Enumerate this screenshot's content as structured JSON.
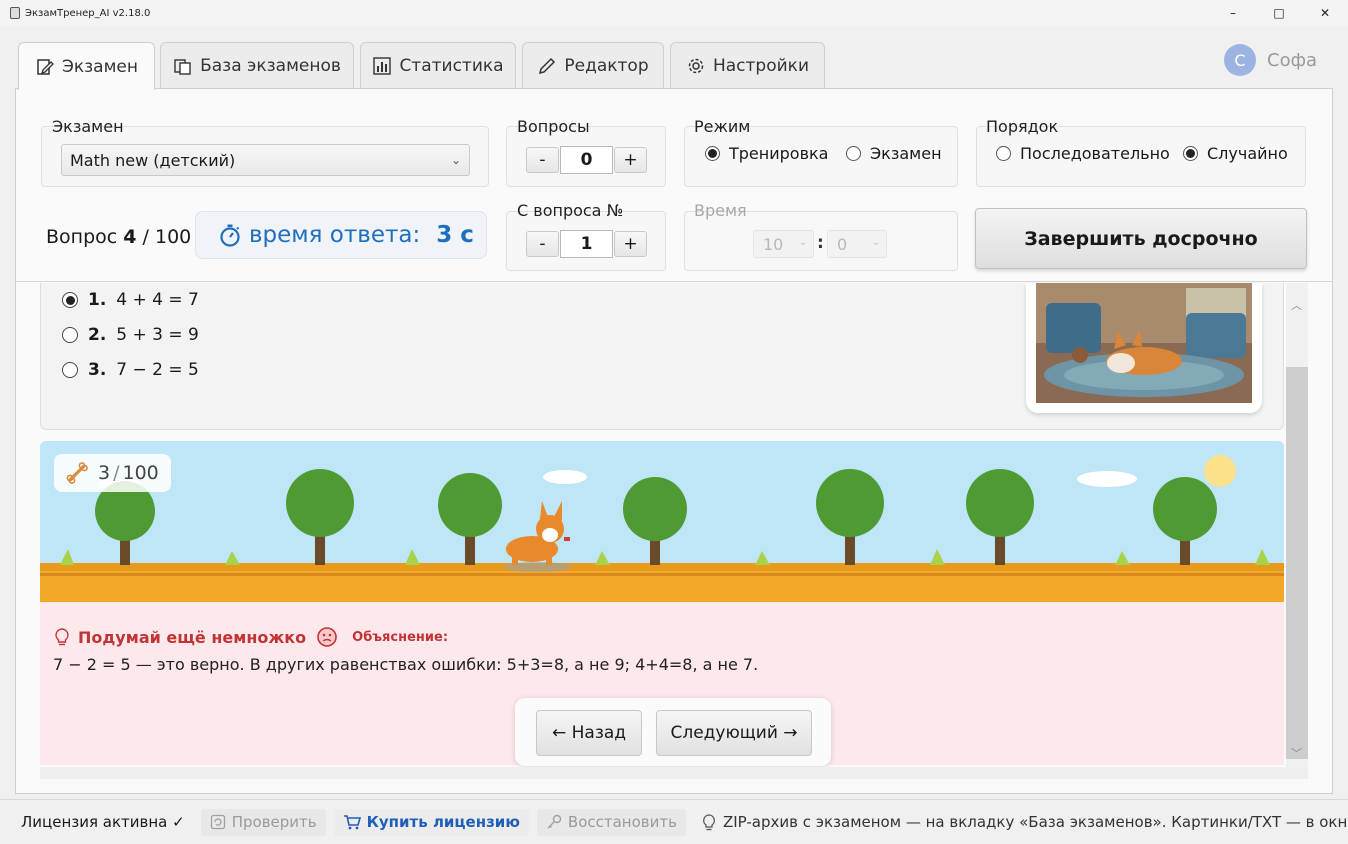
{
  "window": {
    "title": "ЭкзамТренер_AI v2.18.0",
    "minimize": "–",
    "maximize": "□",
    "close": "✕"
  },
  "tabs": [
    {
      "label": "Экзамен",
      "icon": "edit-document-icon"
    },
    {
      "label": "База экзаменов",
      "icon": "copy-icon"
    },
    {
      "label": "Статистика",
      "icon": "bar-chart-icon"
    },
    {
      "label": "Редактор",
      "icon": "pencil-icon"
    },
    {
      "label": "Настройки",
      "icon": "gear-icon"
    }
  ],
  "user": {
    "initial": "С",
    "name": "Софа"
  },
  "exam": {
    "label": "Экзамен",
    "selected": "Math new (детский)"
  },
  "questions": {
    "label": "Вопросы",
    "minus": "-",
    "value": "0",
    "plus": "+"
  },
  "mode": {
    "label": "Режим",
    "options": [
      "Тренировка",
      "Экзамен"
    ],
    "selected": "Тренировка"
  },
  "order": {
    "label": "Порядок",
    "options": [
      "Последовательно",
      "Случайно"
    ],
    "selected": "Случайно"
  },
  "question_counter": {
    "prefix": "Вопрос",
    "current": "4",
    "sep": "/",
    "total": "100"
  },
  "timer": {
    "label": "время ответа:",
    "value": "3 с"
  },
  "from_question": {
    "label": "С вопроса №",
    "minus": "-",
    "value": "1",
    "plus": "+"
  },
  "time_limit": {
    "label": "Время",
    "minutes": "10",
    "colon": ":",
    "seconds": "0"
  },
  "finish_button": "Завершить досрочно",
  "answers": [
    {
      "num": "1.",
      "text": "4 + 4 = 7",
      "selected": true
    },
    {
      "num": "2.",
      "text": "5 + 3 = 9",
      "selected": false
    },
    {
      "num": "3.",
      "text": "7 − 2 = 5",
      "selected": false
    }
  ],
  "game_progress": {
    "value": "3",
    "sep": "/",
    "total": "100"
  },
  "feedback": {
    "hint": "Подумай ещё немножко",
    "explanation_label": "Объяснение:",
    "explanation": "7 − 2 = 5 — это верно. В других равенствах ошибки: 5+3=8, а не 9; 4+4=8, а не 7."
  },
  "navigation": {
    "back": "← Назад",
    "next": "Следующий →"
  },
  "statusbar": {
    "license": "Лицензия активна ✓",
    "check": "Проверить",
    "buy": "Купить лицензию",
    "restore": "Восстановить",
    "tip": "ZIP-архив с экзаменом — на вкладку «База экзаменов». Картинки/TXT — в окно «Собрать экзаме"
  },
  "colors": {
    "accent": "#1f6fbf",
    "hint_red": "#c23436",
    "license_green": "#2e9e44",
    "feedback_bg": "#fde8eb",
    "sky": "#bfe6f7"
  }
}
